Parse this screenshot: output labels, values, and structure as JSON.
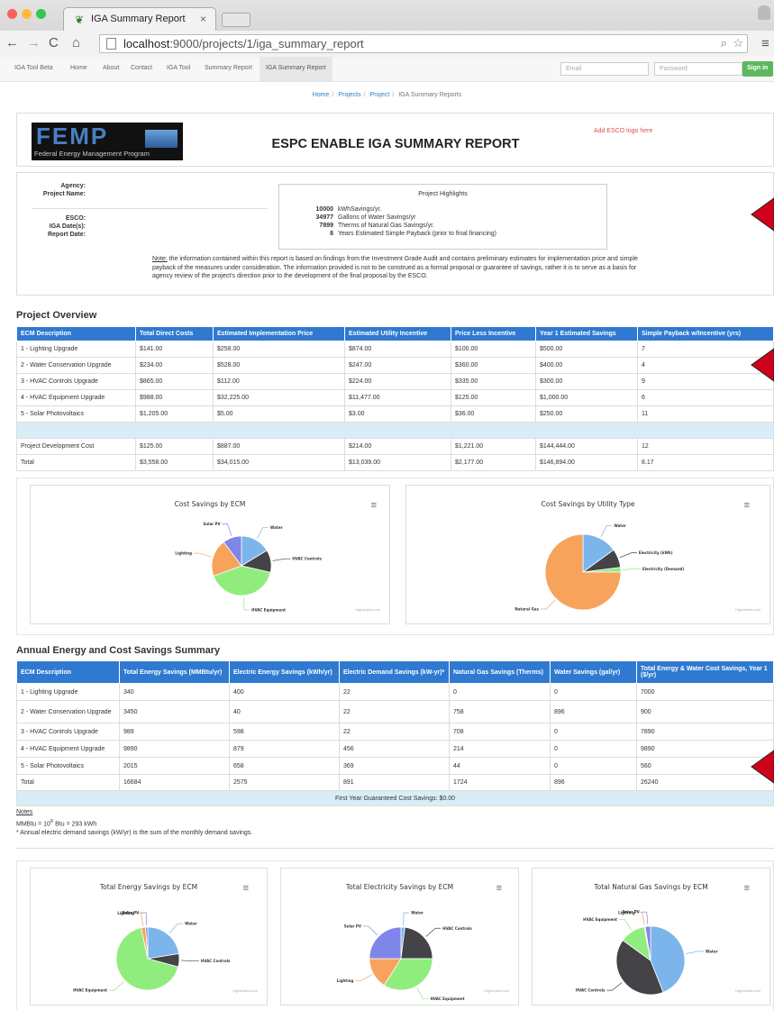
{
  "browser": {
    "tab_title": "IGA Summary Report",
    "url_host": "localhost",
    "url_rest": ":9000/projects/1/iga_summary_report"
  },
  "nav": {
    "brand": "IGA Tool Beta",
    "links": [
      "Home",
      "About",
      "Contact",
      "IGA Tool",
      "Summary Report",
      "IGA Summary Report"
    ],
    "email_placeholder": "Email",
    "password_placeholder": "Password",
    "signin": "Sign in"
  },
  "breadcrumb": [
    "Home",
    "Projects",
    "Project",
    "IGA Summary Reports"
  ],
  "header": {
    "logo_text": "FEMP",
    "logo_subtitle": "Federal Energy Management Program",
    "title": "ESPC ENABLE IGA SUMMARY REPORT",
    "esco_logo": "Add ESCO logo here"
  },
  "info": {
    "agency": "Agency:",
    "project_name": "Project Name:",
    "esco": "ESCO:",
    "iga_dates": "IGA Date(s):",
    "report_date": "Report Date:"
  },
  "highlights": {
    "title": "Project Highlights",
    "rows": [
      {
        "value": "10000",
        "label": "kWhSavings/yr."
      },
      {
        "value": "34977",
        "label": "Gallons of Water Savings/yr"
      },
      {
        "value": "7899",
        "label": "Therms of Natural Gas Savings/yr."
      },
      {
        "value": "8",
        "label": "Years Estimated Simple Payback (prior to final financing)"
      }
    ]
  },
  "note": {
    "prefix": "Note:",
    "text": " the information contained within this report is based on findings from the Investment Grade Audit and contains preliminary estimates for implementation price and simple payback of the measures under consideration. The information provided is not to be construed as a formal proposal or guarantee of savings, rather it is to serve as a basis for agency review of the project's direction prior to the development of the final proposal by the ESCO."
  },
  "overview": {
    "title": "Project Overview",
    "headers": [
      "ECM Description",
      "Total Direct Costs",
      "Estimated Implementation Price",
      "Estimated Utility Incentive",
      "Price Less Incentive",
      "Year 1 Estimated Savings",
      "Simple Payback w/Incentive (yrs)"
    ],
    "rows": [
      [
        "1 - Lighting Upgrade",
        "$141.00",
        "$258.00",
        "$874.00",
        "$100.00",
        "$500.00",
        "7"
      ],
      [
        "2 - Water Conservation Upgrade",
        "$234.00",
        "$528.00",
        "$247.00",
        "$360.00",
        "$400.00",
        "4"
      ],
      [
        "3 - HVAC Controls Upgrade",
        "$865.00",
        "$112.00",
        "$224.00",
        "$335.00",
        "$300.00",
        "9"
      ],
      [
        "4 - HVAC Equipment Upgrade",
        "$988.00",
        "$32,225.00",
        "$11,477.00",
        "$125.00",
        "$1,000.00",
        "6"
      ],
      [
        "5 - Solar Photovoltaics",
        "$1,205.00",
        "$5.00",
        "$3.00",
        "$36.00",
        "$250.00",
        "11"
      ]
    ],
    "dev": [
      "Project Development Cost",
      "$125.00",
      "$887.00",
      "$214.00",
      "$1,221.00",
      "$144,444.00",
      "12"
    ],
    "total": [
      "Total",
      "$3,558.00",
      "$34,015.00",
      "$13,039.00",
      "$2,177.00",
      "$146,894.00",
      "8.17"
    ]
  },
  "annual": {
    "title": "Annual Energy and Cost Savings Summary",
    "headers": [
      "ECM Description",
      "Total Energy Savings (MMBtu/yr)",
      "Electric Energy Savings (kWh/yr)",
      "Electric Demand Savings (kW-yr)*",
      "Natural Gas Savings (Therms)",
      "Water Savings (gal/yr)",
      "Total Energy & Water Cost Savings, Year 1 ($/yr)"
    ],
    "rows": [
      [
        "1 - Lighting Upgrade",
        "340",
        "400",
        "22",
        "0",
        "0",
        "7000"
      ],
      [
        "2 - Water Conservation Upgrade",
        "3450",
        "40",
        "22",
        "758",
        "896",
        "900"
      ],
      [
        "3 - HVAC Controls Upgrade",
        "989",
        "598",
        "22",
        "708",
        "0",
        "7890"
      ],
      [
        "4 - HVAC Equipment Upgrade",
        "9890",
        "879",
        "456",
        "214",
        "0",
        "9890"
      ],
      [
        "5 - Solar Photovoltaics",
        "2015",
        "658",
        "369",
        "44",
        "0",
        "560"
      ],
      [
        "Total",
        "16684",
        "2575",
        "891",
        "1724",
        "896",
        "26240"
      ]
    ],
    "guaranteed": "First Year Guaranteed Cost Savings: $0.00",
    "notes_title": "Notes",
    "mmbtu_a": "MMBtu = 10",
    "mmbtu_sup": "6",
    "mmbtu_b": " Btu = 293 kWh",
    "demand_note": "* Annual electric demand savings (kW/yr) is the sum of the monthly demand savings."
  },
  "chart_data": [
    {
      "type": "pie",
      "title": "Cost Savings by ECM",
      "labels": [
        "Water",
        "HVAC Controls",
        "HVAC Equipment",
        "Lighting",
        "Solar PV"
      ],
      "values": [
        400,
        300,
        1000,
        500,
        250
      ],
      "colors": [
        "#7cb5ec",
        "#434348",
        "#90ed7d",
        "#f7a35c",
        "#8085e9"
      ]
    },
    {
      "type": "pie",
      "title": "Cost Savings by Utility Type",
      "labels": [
        "Water",
        "Electricity (kWh)",
        "Electricity (Demand)",
        "Natural Gas"
      ],
      "values": [
        15,
        8,
        2,
        75
      ],
      "colors": [
        "#7cb5ec",
        "#434348",
        "#90ed7d",
        "#f7a35c"
      ]
    },
    {
      "type": "pie",
      "title": "Total Energy Savings by ECM",
      "labels": [
        "Water",
        "HVAC Controls",
        "HVAC Equipment",
        "Lighting",
        "Solar PV"
      ],
      "values": [
        20,
        6,
        60,
        2,
        1
      ],
      "colors": [
        "#7cb5ec",
        "#434348",
        "#90ed7d",
        "#f7a35c",
        "#8085e9"
      ]
    },
    {
      "type": "pie",
      "title": "Total Electricity Savings by ECM",
      "labels": [
        "Water",
        "HVAC Controls",
        "HVAC Equipment",
        "Lighting",
        "Solar PV"
      ],
      "values": [
        2,
        23,
        34,
        16,
        25
      ],
      "colors": [
        "#7cb5ec",
        "#434348",
        "#90ed7d",
        "#f7a35c",
        "#8085e9"
      ]
    },
    {
      "type": "pie",
      "title": "Total Natural Gas Savings by ECM",
      "labels": [
        "Water",
        "HVAC Controls",
        "HVAC Equipment",
        "Lighting",
        "Solar PV"
      ],
      "values": [
        44,
        41,
        12,
        0.5,
        2.5
      ],
      "colors": [
        "#7cb5ec",
        "#434348",
        "#90ed7d",
        "#f7a35c",
        "#8085e9"
      ]
    }
  ],
  "credit": "Highcharts.com"
}
